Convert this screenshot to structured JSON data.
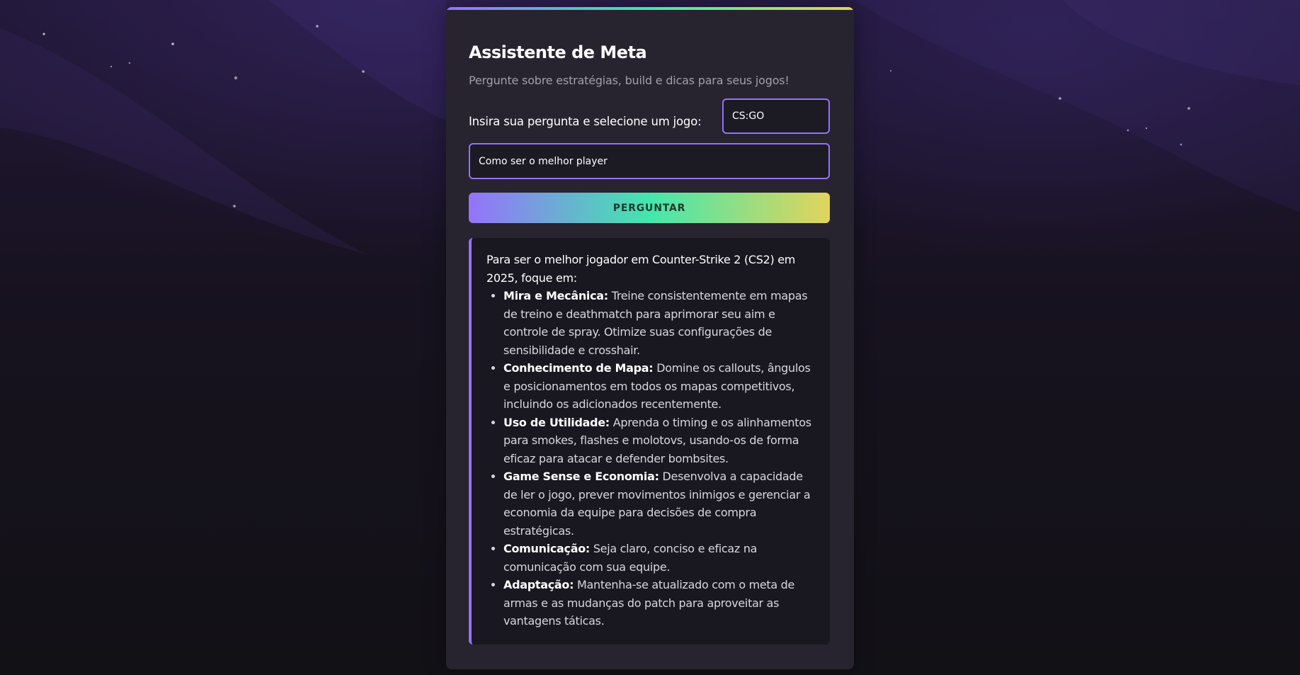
{
  "app": {
    "title": "Assistente de Meta",
    "subtitle": "Pergunte sobre estratégias, build e dicas para seus jogos!"
  },
  "form": {
    "prompt_label": "Insira sua pergunta e selecione um jogo:",
    "game_select": {
      "selected": "CS:GO"
    },
    "question_input": {
      "value": "Como ser o melhor player"
    },
    "ask_button_label": "PERGUNTAR"
  },
  "answer": {
    "intro": "Para ser o melhor jogador em Counter-Strike 2 (CS2) em 2025, foque em:",
    "items": [
      {
        "title": "Mira e Mecânica:",
        "text": "Treine consistentemente em mapas de treino e deathmatch para aprimorar seu aim e controle de spray. Otimize suas configurações de sensibilidade e crosshair."
      },
      {
        "title": "Conhecimento de Mapa:",
        "text": "Domine os callouts, ângulos e posicionamentos em todos os mapas competitivos, incluindo os adicionados recentemente."
      },
      {
        "title": "Uso de Utilidade:",
        "text": "Aprenda o timing e os alinhamentos para smokes, flashes e molotovs, usando-os de forma eficaz para atacar e defender bombsites."
      },
      {
        "title": "Game Sense e Economia:",
        "text": "Desenvolva a capacidade de ler o jogo, prever movimentos inimigos e gerenciar a economia da equipe para decisões de compra estratégicas."
      },
      {
        "title": "Comunicação:",
        "text": "Seja claro, conciso e eficaz na comunicação com sua equipe."
      },
      {
        "title": "Adaptação:",
        "text": "Mantenha-se atualizado com o meta de armas e as mudanças do patch para aproveitar as vantagens táticas."
      }
    ]
  },
  "colors": {
    "accent_purple": "#9572fc",
    "accent_green": "#43e7ad",
    "accent_yellow": "#e2d45c",
    "card_background": "#27242f",
    "answer_background": "#19171f"
  }
}
